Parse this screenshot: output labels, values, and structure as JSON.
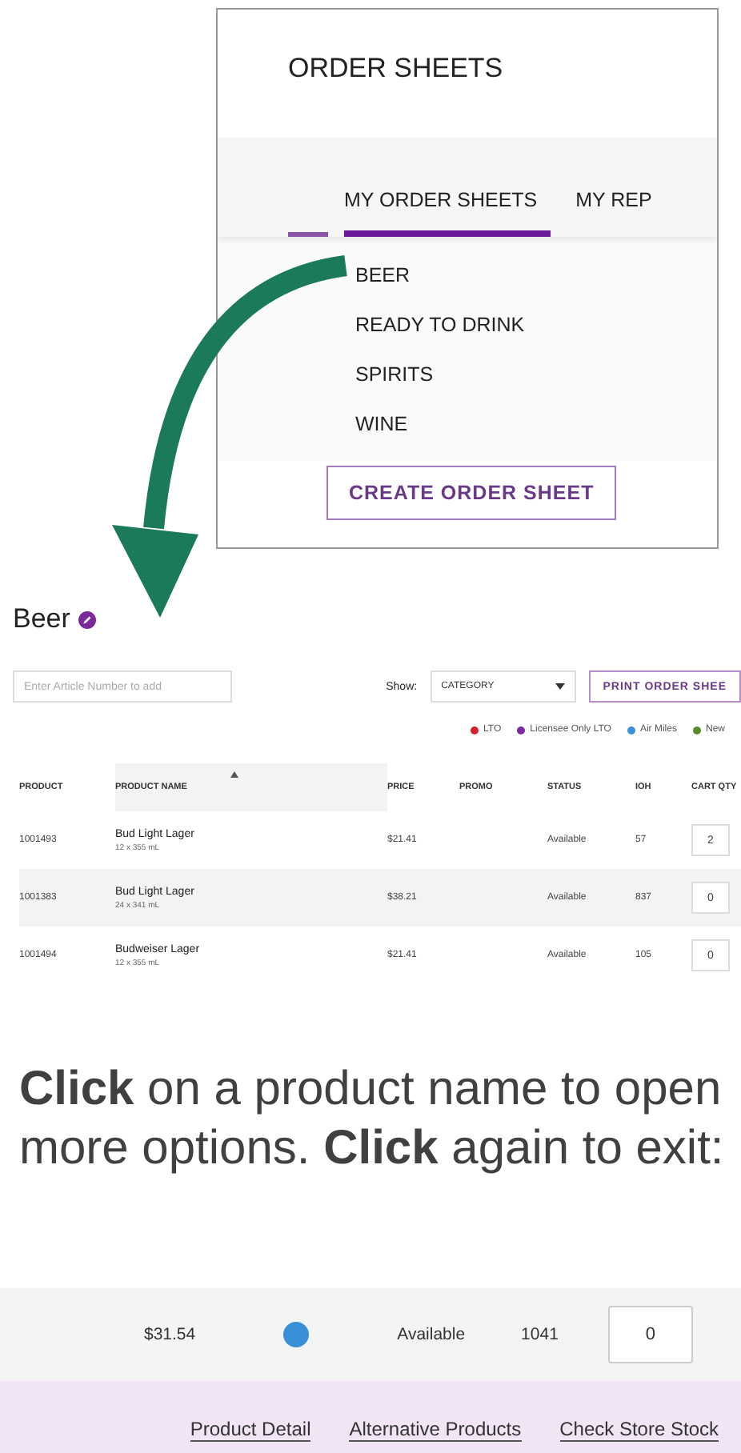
{
  "order_sheets_panel": {
    "title": "ORDER SHEETS",
    "tabs": [
      {
        "label": "MY ORDER SHEETS",
        "selected": true
      },
      {
        "label": "MY REP",
        "selected": false
      }
    ],
    "menu": [
      "BEER",
      "READY TO DRINK",
      "SPIRITS",
      "WINE"
    ],
    "create_button": "CREATE ORDER SHEET"
  },
  "order_sheet": {
    "title": "Beer",
    "article_field": {
      "placeholder": "Enter Article Number to add"
    },
    "show_label": "Show:",
    "show_select": "CATEGORY",
    "print_button": "PRINT ORDER SHEE",
    "legend": [
      {
        "label": "LTO",
        "color": "#d3222f"
      },
      {
        "label": "Licensee Only LTO",
        "color": "#7a2a9a"
      },
      {
        "label": "Air Miles",
        "color": "#3a8fd9"
      },
      {
        "label": "New",
        "color": "#5a8a2a"
      }
    ],
    "table": {
      "columns": [
        {
          "label": "PRODUCT",
          "sorted": false
        },
        {
          "label": "PRODUCT NAME",
          "sorted": true
        },
        {
          "label": "PRICE",
          "sorted": false
        },
        {
          "label": "PROMO",
          "sorted": false
        },
        {
          "label": "STATUS",
          "sorted": false
        },
        {
          "label": "IOH",
          "sorted": false
        },
        {
          "label": "CART QTY",
          "sorted": false
        }
      ],
      "rows": [
        {
          "product": "1001493",
          "name": "Bud Light Lager",
          "size": "12 x 355 mL",
          "price": "$21.41",
          "status": "Available",
          "ioh": "57",
          "cart_qty": "2"
        },
        {
          "product": "1001383",
          "name": "Bud Light Lager",
          "size": "24 x 341 mL",
          "price": "$38.21",
          "status": "Available",
          "ioh": "837",
          "cart_qty": "0"
        },
        {
          "product": "1001494",
          "name": "Budweiser Lager",
          "size": "12 x 355 mL",
          "price": "$21.41",
          "status": "Available",
          "ioh": "105",
          "cart_qty": "0"
        }
      ]
    }
  },
  "instruction": "**Click** on a product name to open more options. **Click** again to exit:",
  "expanded_row": {
    "price": "$31.54",
    "promo_dot": {
      "color": "#3a8fd9"
    },
    "status": "Available",
    "ioh": "1041",
    "cart_qty": "0",
    "links": [
      "Product Detail",
      "Alternative Products",
      "Check Store Stock"
    ]
  }
}
